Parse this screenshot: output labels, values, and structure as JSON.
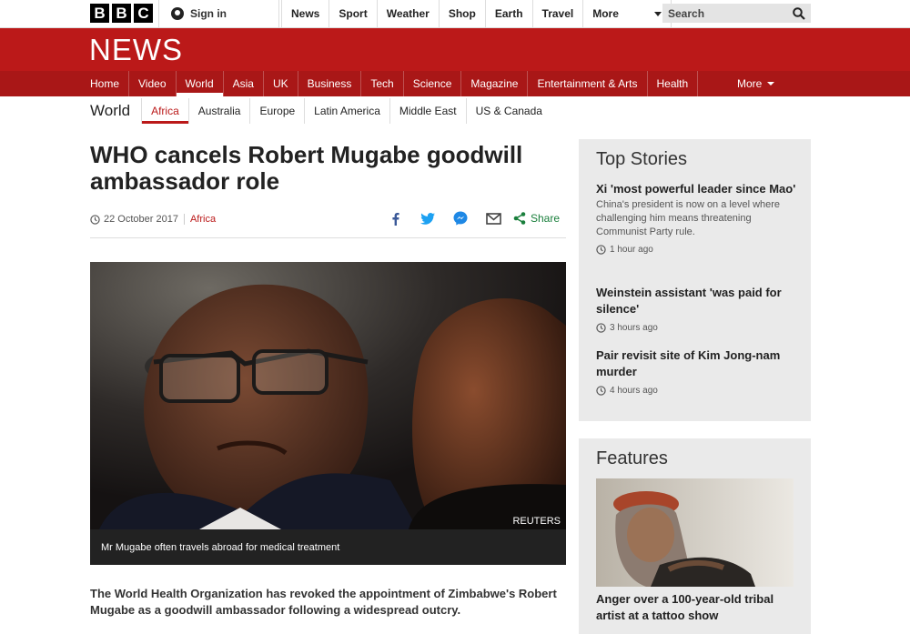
{
  "top_bar": {
    "logo_letters": [
      "B",
      "B",
      "C"
    ],
    "signin_label": "Sign in",
    "nav": [
      "News",
      "Sport",
      "Weather",
      "Shop",
      "Earth",
      "Travel"
    ],
    "more_label": "More",
    "search_label": "Search"
  },
  "banner": {
    "title": "NEWS",
    "color": "#bb1919"
  },
  "section_nav": {
    "items": [
      "Home",
      "Video",
      "World",
      "Asia",
      "UK",
      "Business",
      "Tech",
      "Science",
      "Magazine",
      "Entertainment & Arts",
      "Health"
    ],
    "active": "World",
    "more_label": "More"
  },
  "sub_nav": {
    "title": "World",
    "items": [
      "Africa",
      "Australia",
      "Europe",
      "Latin America",
      "Middle East",
      "US & Canada"
    ],
    "active": "Africa"
  },
  "article": {
    "headline": "WHO cancels Robert Mugabe goodwill ambassador role",
    "date": "22 October 2017",
    "category": "Africa",
    "share_label": "Share",
    "image_credit": "REUTERS",
    "caption": "Mr Mugabe often travels abroad for medical treatment",
    "intro": "The World Health Organization has revoked the appointment of Zimbabwe's Robert Mugabe as a goodwill ambassador following a widespread outcry."
  },
  "top_stories": {
    "title": "Top Stories",
    "items": [
      {
        "title": "Xi 'most powerful leader since Mao'",
        "summary": "China's president is now on a level where challenging him means threatening Communist Party rule.",
        "time": "1 hour ago"
      },
      {
        "title": "Weinstein assistant 'was paid for silence'",
        "time": "3 hours ago"
      },
      {
        "title": "Pair revisit site of Kim Jong-nam murder",
        "time": "4 hours ago"
      }
    ]
  },
  "features": {
    "title": "Features",
    "item_title": "Anger over a 100-year-old tribal artist at a tattoo show"
  }
}
